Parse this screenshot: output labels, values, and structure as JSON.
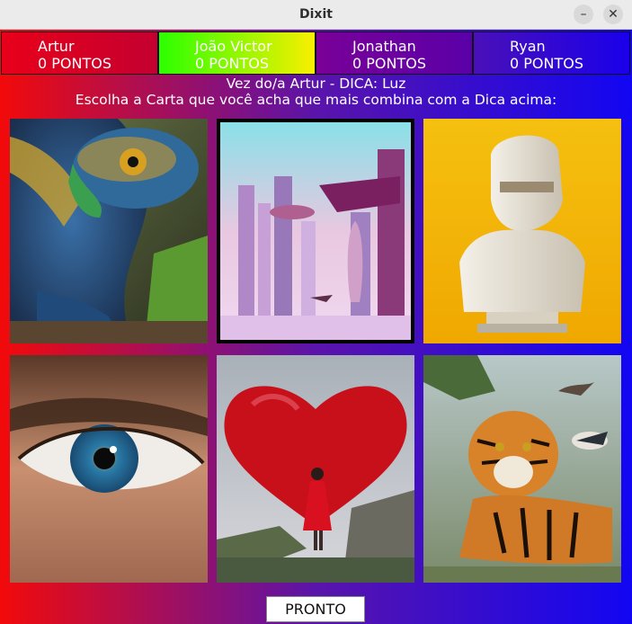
{
  "window": {
    "title": "Dixit",
    "minimize_symbol": "–",
    "close_symbol": "✕"
  },
  "scoreboard": [
    {
      "name": "Artur",
      "points": "0 PONTOS"
    },
    {
      "name": "João Victor",
      "points": "0 PONTOS"
    },
    {
      "name": "Jonathan",
      "points": "0 PONTOS"
    },
    {
      "name": "Ryan",
      "points": "0 PONTOS"
    }
  ],
  "hint": {
    "line1": "Vez do/a Artur - DICA: Luz",
    "line2": "Escolha a Carta que você acha que mais combina com a Dica acima:"
  },
  "cards": [
    {
      "image": "iguana-card-icon",
      "selected": false
    },
    {
      "image": "futuristic-city-card-icon",
      "selected": true
    },
    {
      "image": "robot-bust-card-icon",
      "selected": false
    },
    {
      "image": "human-eye-card-icon",
      "selected": false
    },
    {
      "image": "red-heart-girl-card-icon",
      "selected": false
    },
    {
      "image": "tiger-birds-card-icon",
      "selected": false
    }
  ],
  "actions": {
    "ready_label": "PRONTO"
  },
  "colors": {
    "background_left": "#f20a0a",
    "background_mid": "#5a14aa",
    "background_right": "#1206f2",
    "selected_border": "#000000"
  }
}
